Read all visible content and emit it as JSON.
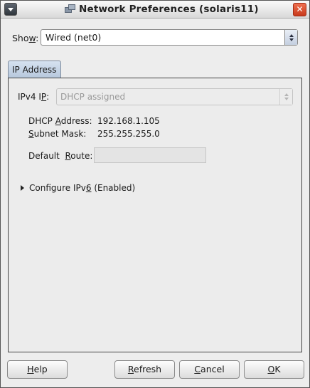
{
  "window": {
    "title": "Network Preferences (solaris11)",
    "close_glyph": "✕"
  },
  "show": {
    "label_pre": "Sho",
    "label_mnemonic": "w",
    "label_post": ":",
    "selected": "Wired (net0)"
  },
  "tabs": [
    {
      "label": "IP Address",
      "active": true
    }
  ],
  "ipv4": {
    "label_pre": "IPv4 I",
    "label_mnemonic": "P",
    "label_post": ":",
    "selected": "DHCP assigned",
    "enabled": false
  },
  "dhcp_address": {
    "label_pre": "DHCP ",
    "label_mnemonic": "A",
    "label_post": "ddress:",
    "value": "192.168.1.105"
  },
  "subnet_mask": {
    "label_mnemonic": "S",
    "label_post": "ubnet Mask:",
    "value": "255.255.255.0"
  },
  "default_route": {
    "label_pre": "Default  ",
    "label_mnemonic": "R",
    "label_post": "oute:",
    "value": ""
  },
  "ipv6": {
    "label_pre": "Configure IPv",
    "label_mnemonic": "6",
    "label_post": " (Enabled)",
    "expanded": false
  },
  "buttons": {
    "help": {
      "mnemonic": "H",
      "rest": "elp"
    },
    "refresh": {
      "mnemonic": "R",
      "rest": "efresh"
    },
    "cancel": {
      "mnemonic": "C",
      "rest": "ancel"
    },
    "ok": {
      "mnemonic": "O",
      "rest": "K"
    }
  },
  "colors": {
    "close_button": "#d9502e",
    "tab_active": "#c3d3e6",
    "window_bg": "#ededed"
  }
}
